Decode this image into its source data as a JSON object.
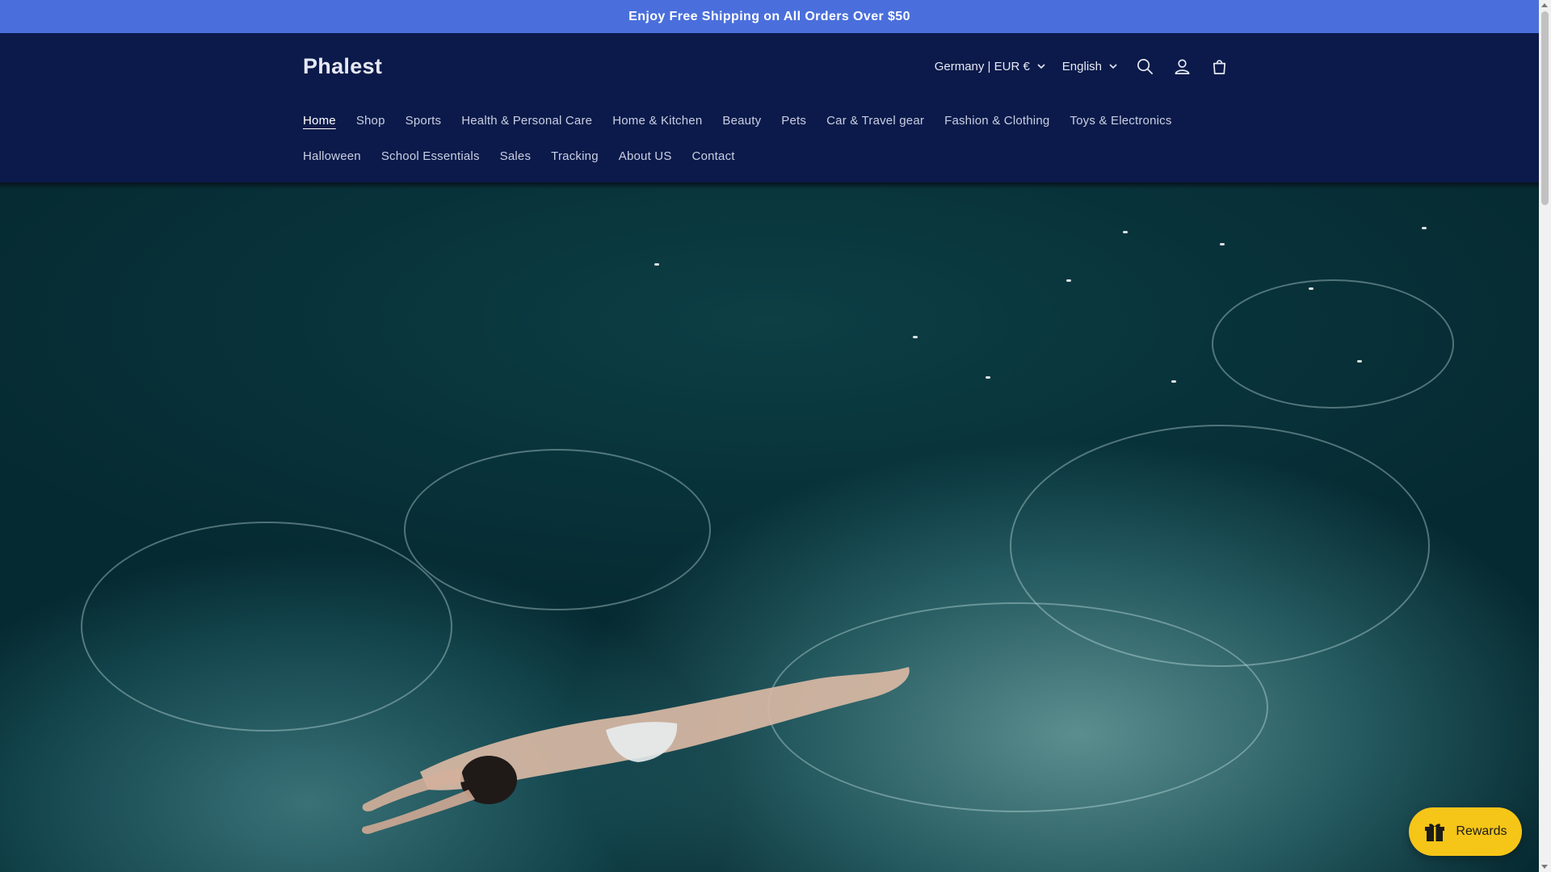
{
  "announcement": {
    "text": "Enjoy Free Shipping on All Orders Over $50"
  },
  "header": {
    "logo": "Phalest",
    "country_selector": "Germany | EUR €",
    "language_selector": "English",
    "icons": {
      "search": "search-icon",
      "account": "account-icon",
      "cart": "cart-icon"
    }
  },
  "nav": {
    "items": [
      {
        "label": "Home",
        "active": true
      },
      {
        "label": "Shop"
      },
      {
        "label": "Sports"
      },
      {
        "label": "Health & Personal Care"
      },
      {
        "label": "Home & Kitchen"
      },
      {
        "label": "Beauty"
      },
      {
        "label": "Pets"
      },
      {
        "label": "Car & Travel gear"
      },
      {
        "label": "Fashion & Clothing"
      },
      {
        "label": "Toys & Electronics"
      },
      {
        "label": "Halloween"
      },
      {
        "label": "School Essentials"
      },
      {
        "label": "Sales"
      },
      {
        "label": "Tracking"
      },
      {
        "label": "About US"
      },
      {
        "label": "Contact"
      }
    ]
  },
  "rewards": {
    "label": "Rewards",
    "icon": "gift-icon"
  },
  "colors": {
    "announcement_bg": "#4a6fdc",
    "header_bg": "#0b1a4a",
    "rewards_bg": "#f5c518"
  }
}
